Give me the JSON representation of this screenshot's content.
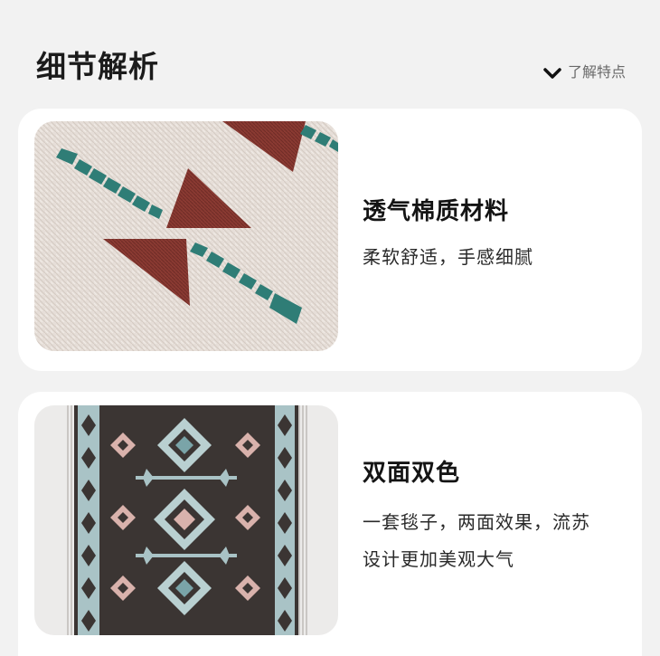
{
  "header": {
    "title": "细节解析",
    "more_label": "了解特点",
    "more_icon": "chevron-down-icon"
  },
  "cards": [
    {
      "image": "woven-fabric-closeup-photo",
      "title": "透气棉质材料",
      "description": "柔软舒适，手感细腻"
    },
    {
      "image": "double-sided-blanket-photo",
      "title": "双面双色",
      "description_lines": [
        "一套毯子，两面效果，流苏",
        "设计更加美观大气"
      ]
    }
  ],
  "colors": {
    "page_bg": "#f2f2f2",
    "card_bg": "#ffffff",
    "fabric_cream": "#e8e0da",
    "rust_red": "#8a3a32",
    "teal": "#2f7d76",
    "blanket_dark": "#3b3533",
    "blanket_light_blue": "#a9c3c6",
    "blanket_pink": "#d9b2ac"
  }
}
